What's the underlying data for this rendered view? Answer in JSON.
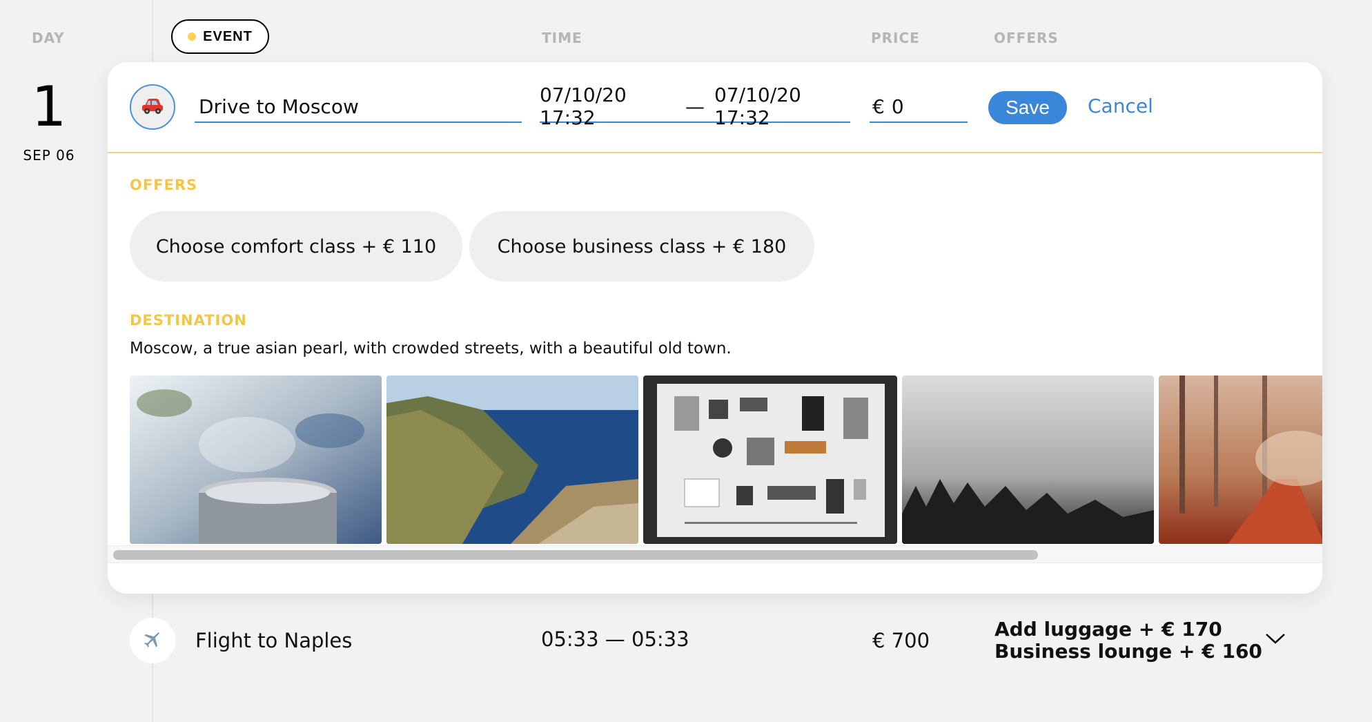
{
  "header": {
    "day": "DAY",
    "event": "EVENT",
    "time": "TIME",
    "price": "PRICE",
    "offers": "OFFERS"
  },
  "day": {
    "number": "1",
    "date": "SEP 06"
  },
  "edit_form": {
    "type_icon": "car-icon",
    "destination_value": "Drive to Moscow",
    "start_time": "07/10/20 17:32",
    "time_separator": "—",
    "end_time": "07/10/20 17:32",
    "price_currency": "€",
    "price_value": "0",
    "save_label": "Save",
    "cancel_label": "Cancel",
    "offers_title": "OFFERS",
    "offers": [
      {
        "label": "Choose comfort class + € 110"
      },
      {
        "label": "Choose business class + € 180"
      }
    ],
    "destination_title": "DESTINATION",
    "destination_description": "Moscow, a true asian pearl, with crowded streets, with a beautiful old town.",
    "photos": [
      "steaming-cup-photo",
      "sea-cliffs-photo",
      "camera-parts-flatlay-photo",
      "foggy-forest-photo",
      "autumn-forest-path-photo"
    ]
  },
  "events": [
    {
      "type_icon": "airplane-icon",
      "title": "Flight to Naples",
      "time": "05:33 — 05:33",
      "price": "€ 700",
      "offers": [
        "Add luggage + € 170",
        "Business lounge + € 160"
      ]
    }
  ],
  "colors": {
    "accent_blue": "#3a86d8",
    "accent_yellow": "#f3c64a",
    "background": "#f2f2f2"
  }
}
